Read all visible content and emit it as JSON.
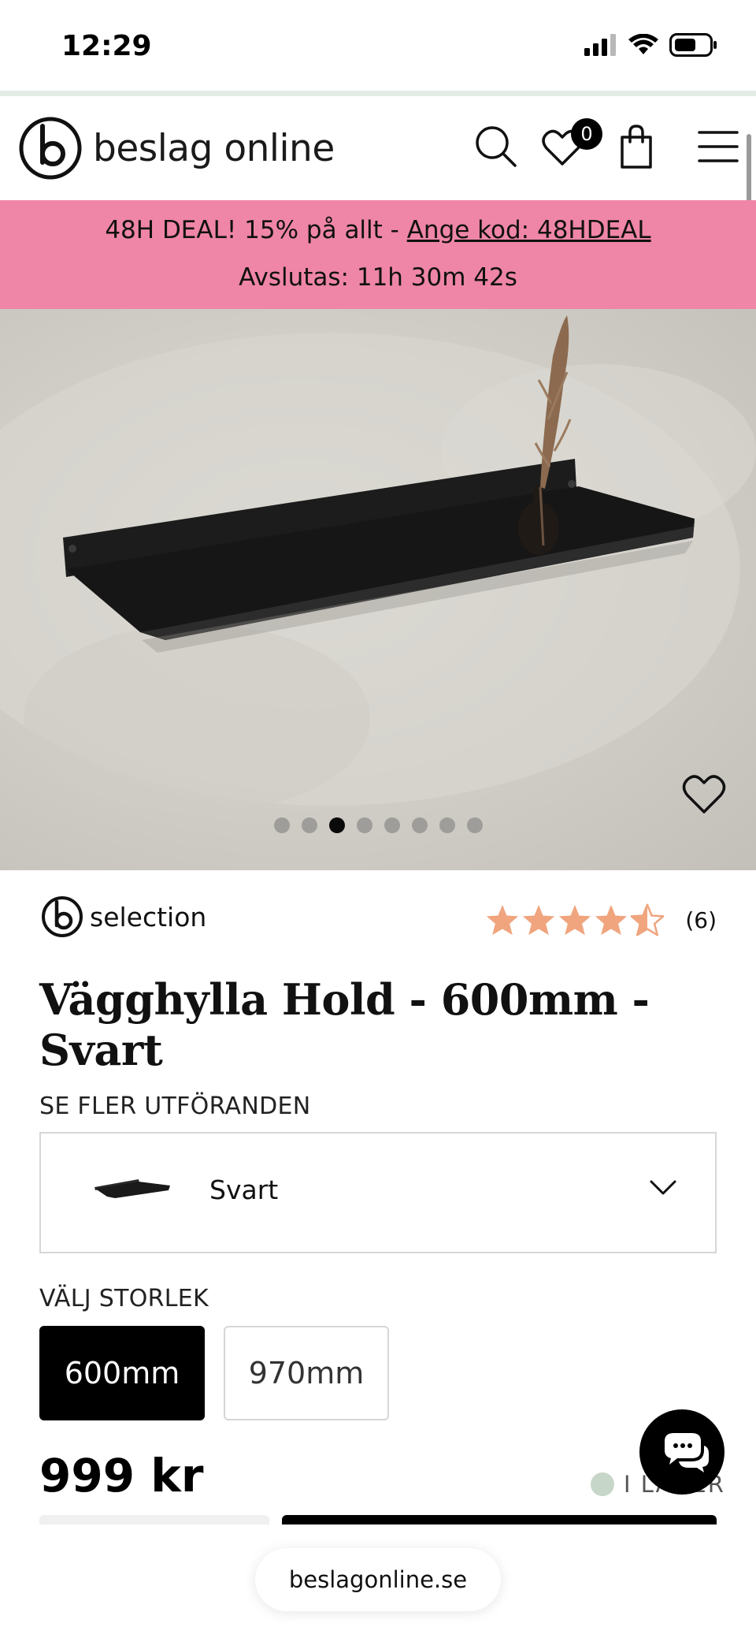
{
  "status_bar": {
    "time": "12:29"
  },
  "header": {
    "logo_text": "beslag online",
    "wishlist_count": "0"
  },
  "promo": {
    "lead": "48H DEAL! 15% på allt - ",
    "code_link": "Ange kod: 48HDEAL",
    "countdown": "Avslutas: 11h 30m 42s"
  },
  "gallery": {
    "image_count": 8,
    "active_index": 2
  },
  "product": {
    "brand": "selection",
    "rating": 4.5,
    "rating_max": 5,
    "review_count": "(6)",
    "title": "Vägghylla Hold - 600mm - Svart",
    "variants_label": "SE FLER UTFÖRANDEN",
    "selected_variant": "Svart",
    "size_label": "VÄLJ STORLEK",
    "sizes": [
      {
        "label": "600mm",
        "selected": true
      },
      {
        "label": "970mm",
        "selected": false
      }
    ],
    "price": "999 kr",
    "stock_status": "I LAGER"
  },
  "browser": {
    "url": "beslagonline.se"
  },
  "colors": {
    "promo_bg": "#ef86a7",
    "star": "#f0a57e",
    "stock_dot": "#c6d6c8"
  }
}
